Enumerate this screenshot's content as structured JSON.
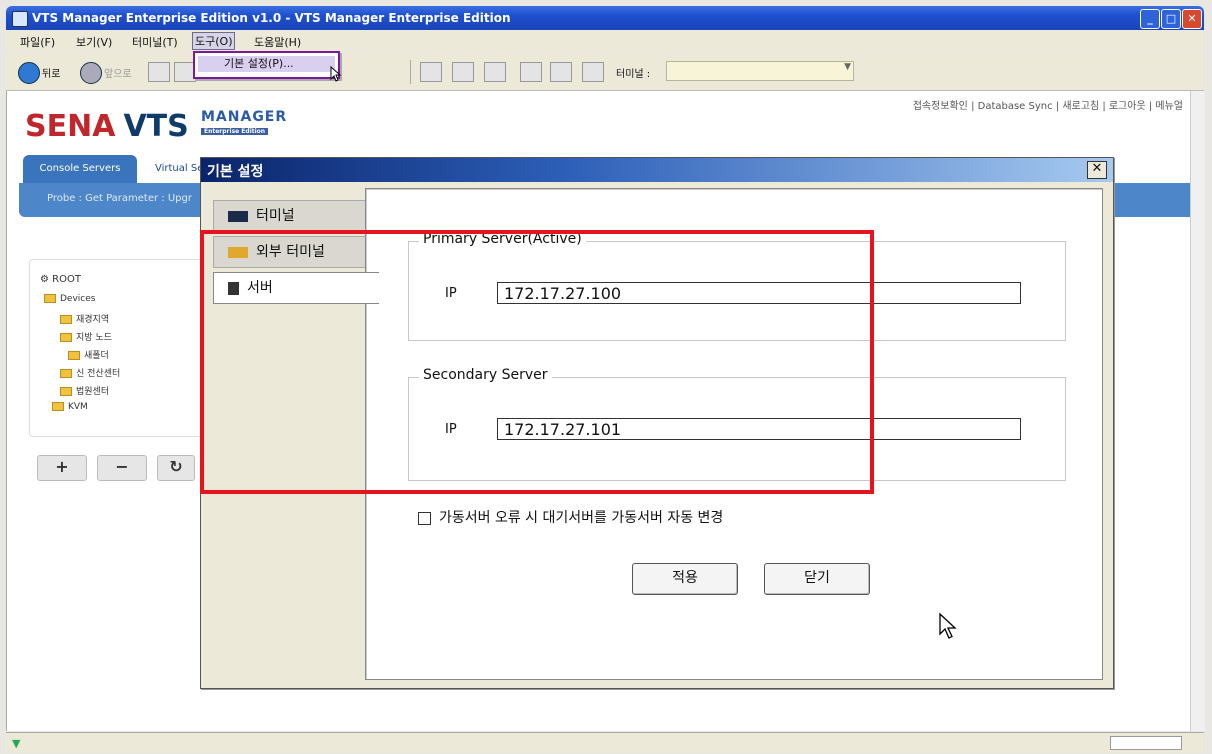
{
  "window": {
    "title": "VTS Manager Enterprise Edition v1.0 - VTS Manager Enterprise Edition"
  },
  "menu": {
    "items": [
      "파일(F)",
      "보기(V)",
      "터미널(T)",
      "도구(O)",
      "도움말(H)"
    ],
    "open_dropdown_item": "기본 설정(P)..."
  },
  "toolbar": {
    "back": "뒤로",
    "forward": "앞으로",
    "terminal_label": "터미널 :",
    "terminal_value": ""
  },
  "page": {
    "top_links": "접속정보확인 | Database Sync | 새로고침 | 로그아웃 | 메뉴얼",
    "logo_brand": "SENA",
    "logo_product": "VTS",
    "logo_manager": "MANAGER",
    "logo_edition": "Enterprise Edition",
    "tabs": [
      "Console Servers",
      "Virtual Se"
    ],
    "subnav": "Probe : Get Parameter : Upgr",
    "tree": {
      "root": "ROOT",
      "devices": "Devices",
      "children": [
        "재경지역",
        "지방 노드",
        "새폴더",
        "신 전산센터",
        "법원센터"
      ],
      "kvm": "KVM"
    },
    "tree_buttons": [
      "+",
      "−",
      "↻"
    ]
  },
  "dialog": {
    "title": "기본 설정",
    "tabs": [
      "터미널",
      "외부 터미널",
      "서버"
    ],
    "active_tab": "서버",
    "primary": {
      "legend": "Primary Server(Active)",
      "ip_label": "IP",
      "ip": "172.17.27.100"
    },
    "secondary": {
      "legend": "Secondary Server",
      "ip_label": "IP",
      "ip": "172.17.27.101"
    },
    "auto_switch": {
      "label": "가동서버 오류 시 대기서버를 가동서버 자동 변경",
      "checked": false
    },
    "apply": "적용",
    "close": "닫기"
  }
}
